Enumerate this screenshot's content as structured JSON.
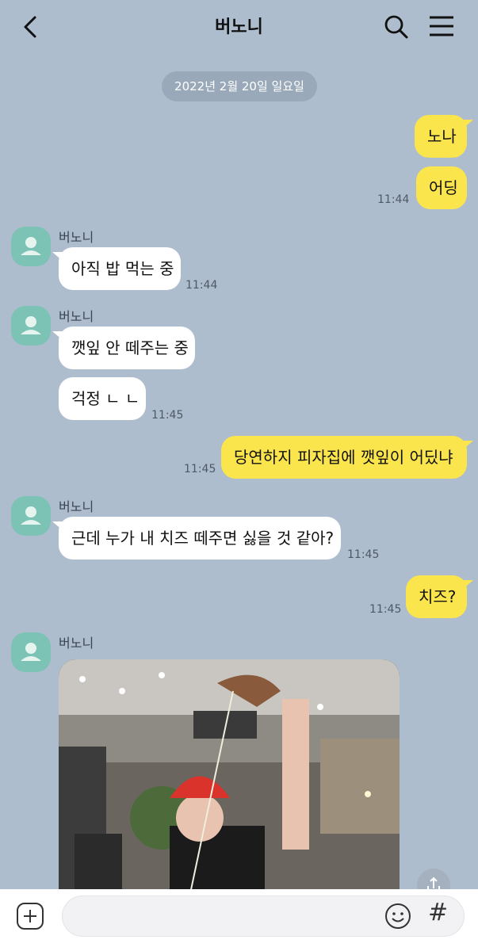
{
  "header": {
    "title": "버노니"
  },
  "date_divider": "2022년 2월 20일 일요일",
  "messages": [
    {
      "from": "me",
      "text": "노나"
    },
    {
      "from": "me",
      "text": "어딩",
      "time": "11:44"
    },
    {
      "from": "them",
      "sender": "버노니",
      "text": "아직 밥 먹는 중",
      "time": "11:44"
    },
    {
      "from": "them",
      "sender": "버노니",
      "text": "깻잎 안 떼주는 중"
    },
    {
      "from": "them",
      "text": "걱정 ㄴ ㄴ",
      "time": "11:45"
    },
    {
      "from": "me",
      "text": "당연하지 피자집에 깻잎이 어딨냐",
      "time": "11:45"
    },
    {
      "from": "them",
      "sender": "버노니",
      "text": "근데 누가 내 치즈 떼주면 싫을 것 같아?",
      "time": "11:45"
    },
    {
      "from": "me",
      "text": "치즈?",
      "time": "11:45"
    },
    {
      "from": "them",
      "sender": "버노니",
      "type": "photo"
    }
  ],
  "colors": {
    "background": "#aebdcd",
    "my_bubble": "#fbe54d",
    "their_bubble": "#ffffff",
    "avatar": "#7cc3b5"
  },
  "icons": [
    "back-icon",
    "search-icon",
    "menu-icon",
    "avatar-icon",
    "share-icon",
    "plus-icon",
    "emoji-icon",
    "hash-icon"
  ],
  "input": {
    "hash_symbol": "#"
  }
}
